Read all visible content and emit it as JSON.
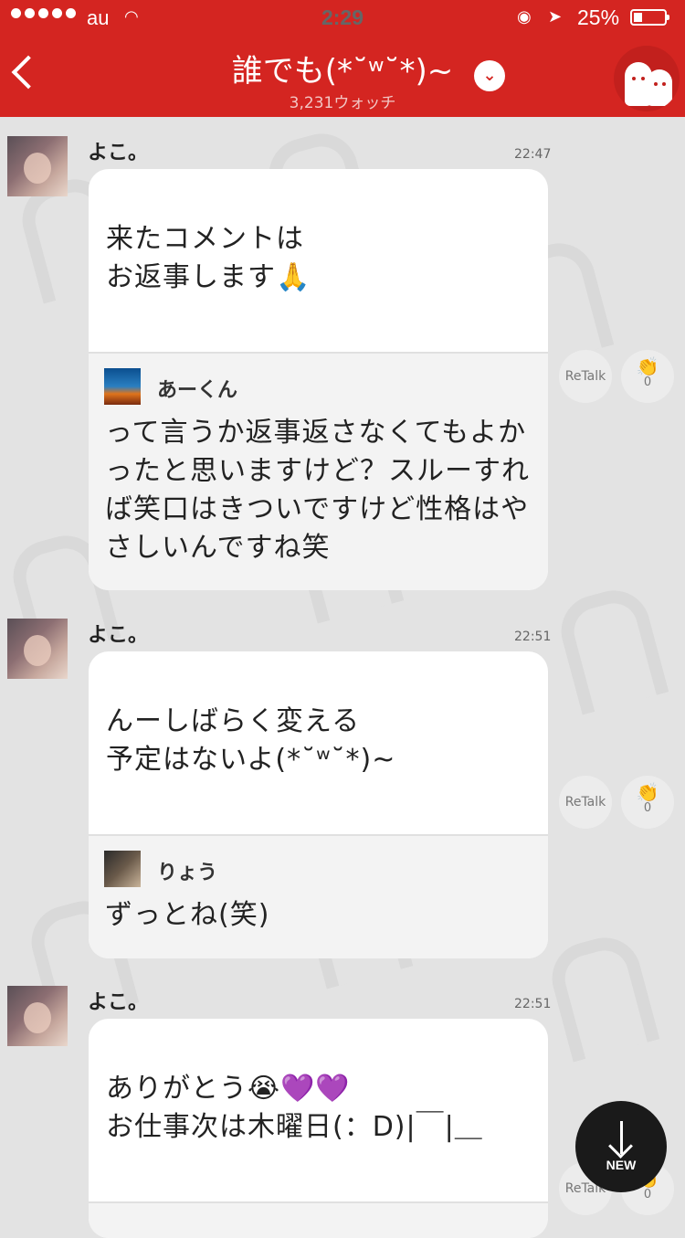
{
  "status_bar": {
    "carrier": "au",
    "time": "2:29",
    "battery": "25%"
  },
  "header": {
    "title": "誰でも( ˘ ³˘)♡",
    "title_display": "誰でも(*˘ʷ˘*)~",
    "watch_count": "3,231ウォッチ"
  },
  "messages": [
    {
      "author": "よこ。",
      "time": "22:47",
      "lines": [
        "来たコメントは",
        "お返事します🙏"
      ],
      "quote": {
        "author": "あーくん",
        "text": "って言うか返事返さなくてもよかったと思いますけど？スルーすれば笑口はきついですけど性格はやさしいんですね笑"
      },
      "retalk_label": "ReTalk",
      "clap_count": "0"
    },
    {
      "author": "よこ。",
      "time": "22:51",
      "lines": [
        "んーしばらく変える",
        "予定はないよ(*˘ʷ˘*)~"
      ],
      "quote": {
        "author": "りょう",
        "text": "ずっとね(笑)"
      },
      "retalk_label": "ReTalk",
      "clap_count": "0"
    },
    {
      "author": "よこ。",
      "time": "22:51",
      "lines": [
        "ありがとう😭💜💜",
        "お仕事次は木曜日(：D)|￣|＿"
      ],
      "retalk_label": "ReTalk",
      "clap_count": "0"
    }
  ],
  "new_button": {
    "label": "NEW"
  },
  "colors": {
    "brand": "#d42521",
    "background": "#e3e3e3"
  }
}
